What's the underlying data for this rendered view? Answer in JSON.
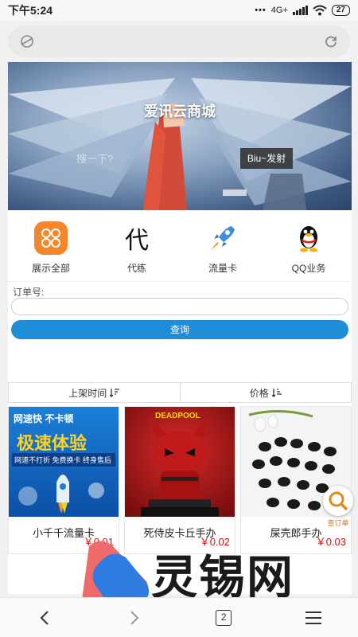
{
  "status_bar": {
    "time": "下午5:24",
    "network": "4G+",
    "battery": "27"
  },
  "banner": {
    "title": "爱讯云商城",
    "input_placeholder": "搜一下?",
    "button_label": "Biu~发射"
  },
  "categories": [
    {
      "label": "展示全部",
      "icon": "grid-icon"
    },
    {
      "label": "代练",
      "icon": "dai-char-icon",
      "glyph": "代"
    },
    {
      "label": "流量卡",
      "icon": "rocket-icon"
    },
    {
      "label": "QQ业务",
      "icon": "qq-penguin-icon"
    }
  ],
  "order": {
    "label": "订单号:",
    "placeholder": "",
    "query_button": "查询"
  },
  "sort": {
    "by_time": "上架时间",
    "by_price": "价格"
  },
  "products": [
    {
      "name": "小千千流量卡",
      "price": "￥0.01",
      "banner_top": "网速快  不卡顿",
      "banner_mid": "极速体验",
      "banner_bot": "网速不打折 免费换卡 终身售后"
    },
    {
      "name": "死侍皮卡丘手办",
      "price": "￥0.02",
      "badge": "DEADPOOL"
    },
    {
      "name": "屎壳郎手办",
      "price": "￥0.03"
    }
  ],
  "float_button": {
    "label": "查订单"
  },
  "watermark": {
    "text": "灵锡网"
  },
  "nav": {
    "tab_count": "2"
  },
  "colors": {
    "accent": "#1f8ed8",
    "price": "#cc1111",
    "orange": "#f5872a"
  }
}
